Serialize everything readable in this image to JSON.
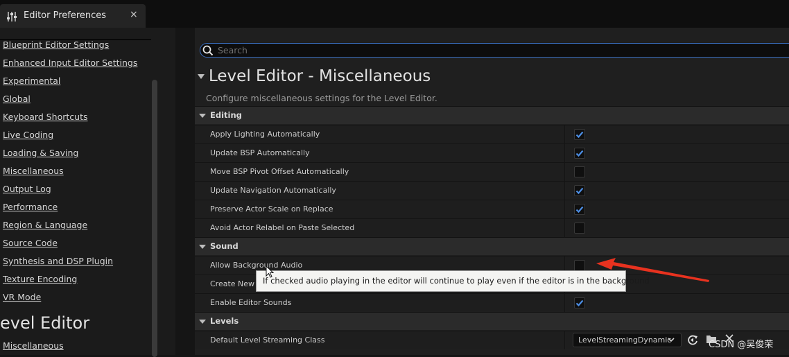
{
  "window": {
    "tab_title": "Editor Preferences",
    "close_glyph": "×"
  },
  "sidebar": {
    "items": [
      {
        "label": "Blueprint Editor Settings"
      },
      {
        "label": "Enhanced Input Editor Settings"
      },
      {
        "label": "Experimental"
      },
      {
        "label": "Global"
      },
      {
        "label": "Keyboard Shortcuts"
      },
      {
        "label": "Live Coding"
      },
      {
        "label": "Loading & Saving"
      },
      {
        "label": "Miscellaneous"
      },
      {
        "label": "Output Log"
      },
      {
        "label": "Performance"
      },
      {
        "label": "Region & Language"
      },
      {
        "label": "Source Code"
      },
      {
        "label": "Synthesis and DSP Plugin"
      },
      {
        "label": "Texture Encoding"
      },
      {
        "label": "VR Mode"
      }
    ],
    "section_title": "evel Editor",
    "section_items": [
      {
        "label": "Miscellaneous"
      }
    ]
  },
  "search": {
    "placeholder": "Search",
    "value": ""
  },
  "main": {
    "title": "Level Editor - Miscellaneous",
    "description": "Configure miscellaneous settings for the Level Editor.",
    "categories": [
      {
        "label": "Editing",
        "props": [
          {
            "label": "Apply Lighting Automatically",
            "checked": true
          },
          {
            "label": "Update BSP Automatically",
            "checked": true
          },
          {
            "label": "Move BSP Pivot Offset Automatically",
            "checked": false
          },
          {
            "label": "Update Navigation Automatically",
            "checked": true
          },
          {
            "label": "Preserve Actor Scale on Replace",
            "checked": true
          },
          {
            "label": "Avoid Actor Relabel on Paste Selected",
            "checked": false
          }
        ]
      },
      {
        "label": "Sound",
        "props": [
          {
            "label": "Allow Background Audio",
            "checked": false
          },
          {
            "label": "Create New A",
            "checked": null
          },
          {
            "label": "Enable Editor Sounds",
            "checked": true
          }
        ]
      },
      {
        "label": "Levels",
        "props": [
          {
            "label": "Default Level Streaming Class",
            "value": "LevelStreamingDynamic"
          }
        ]
      }
    ]
  },
  "tooltip": {
    "text": "If checked audio playing in the editor will continue to play even if the editor is in the background"
  },
  "watermark": "CSDN @吴俊荣",
  "colors": {
    "accent": "#3a6fc2",
    "check": "#4d8fe6",
    "annotation": "#e8321f"
  }
}
